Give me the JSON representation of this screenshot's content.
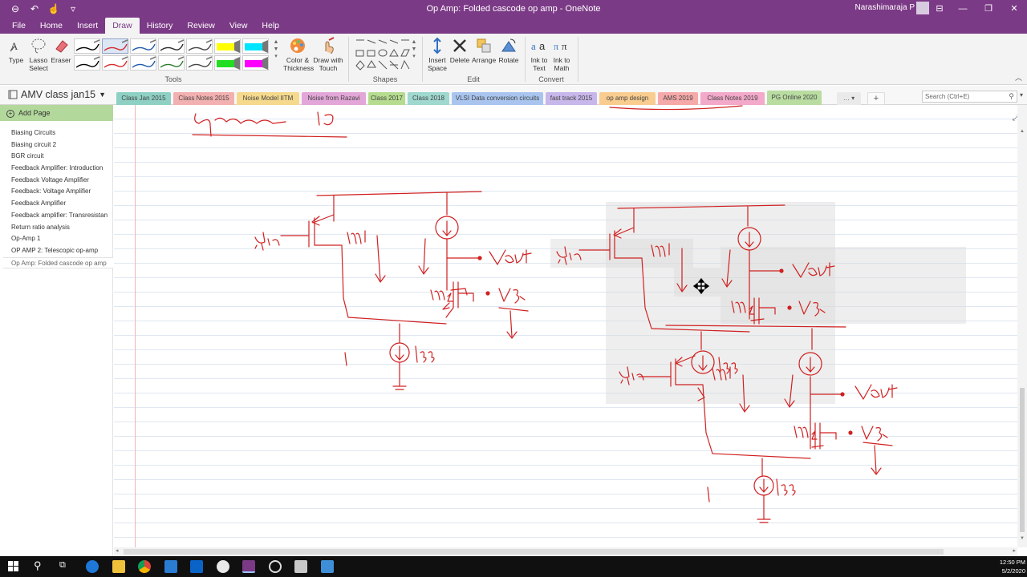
{
  "window": {
    "title": "Op Amp: Folded cascode op amp  -  OneNote",
    "user": "Narashimaraja P"
  },
  "menu": {
    "tabs": [
      "File",
      "Home",
      "Insert",
      "Draw",
      "History",
      "Review",
      "View",
      "Help"
    ],
    "active": "Draw"
  },
  "ribbon": {
    "tools": {
      "type_label": "Type",
      "lasso_label": "Lasso Select",
      "eraser_label": "Eraser",
      "color_label": "Color & Thickness",
      "draw_touch_label": "Draw with Touch",
      "group_label": "Tools"
    },
    "shapes": {
      "group_label": "Shapes"
    },
    "edit": {
      "insert_space_label": "Insert Space",
      "delete_label": "Delete",
      "arrange_label": "Arrange",
      "rotate_label": "Rotate",
      "group_label": "Edit"
    },
    "convert": {
      "ink_text_label": "Ink to Text",
      "ink_math_label": "Ink to Math",
      "group_label": "Convert"
    },
    "pen_colors": [
      "#000000",
      "#d42a2a",
      "#1f5aa8",
      "#2a2a2a",
      "#444444",
      "#ffff00",
      "#00e5ff",
      "#000000",
      "#d42a2a",
      "#1f5aa8",
      "#2c7c2c",
      "#444444",
      "#22dd22",
      "#ff00ff"
    ]
  },
  "notebook": {
    "name": "AMV class jan15",
    "sections": [
      {
        "label": "Class Jan 2015",
        "color": "#8ed1c4"
      },
      {
        "label": "Class Notes 2015",
        "color": "#f3b0b0"
      },
      {
        "label": "Noise Model IITM",
        "color": "#f5d98c"
      },
      {
        "label": "Noise from Razavi",
        "color": "#e3a6d8"
      },
      {
        "label": "Class 2017",
        "color": "#b5dc8f"
      },
      {
        "label": "Class 2018",
        "color": "#9fd8cf"
      },
      {
        "label": "VLSI Data conversion circuits",
        "color": "#a9c5ef"
      },
      {
        "label": "fast track 2015",
        "color": "#c8b7ea"
      },
      {
        "label": "op amp design",
        "color": "#f9cd8f"
      },
      {
        "label": "AMS 2019",
        "color": "#f6a9a9"
      },
      {
        "label": "Class Notes 2019",
        "color": "#f3a9c9"
      },
      {
        "label": "PG Online 2020",
        "color": "#b9dca1"
      }
    ],
    "search_placeholder": "Search (Ctrl+E)"
  },
  "pages": {
    "add_label": "Add Page",
    "items": [
      "Biasing Circuits",
      "Biasing circuit 2",
      "BGR circuit",
      "Feedback Amplifier: Introduction",
      "Feedback Voltage Amplifier",
      "Feedback: Voltage Amplifier",
      "Feedback Amplifier",
      "Feedback amplifier: Transresistan",
      "Return ratio analysis",
      "Op-Amp 1",
      "OP AMP 2: Telescopic op-amp",
      "Op Amp: Folded cascode op amp"
    ],
    "selected_index": 11
  },
  "clock": {
    "time": "12:50 PM",
    "date": "5/2/2020"
  }
}
